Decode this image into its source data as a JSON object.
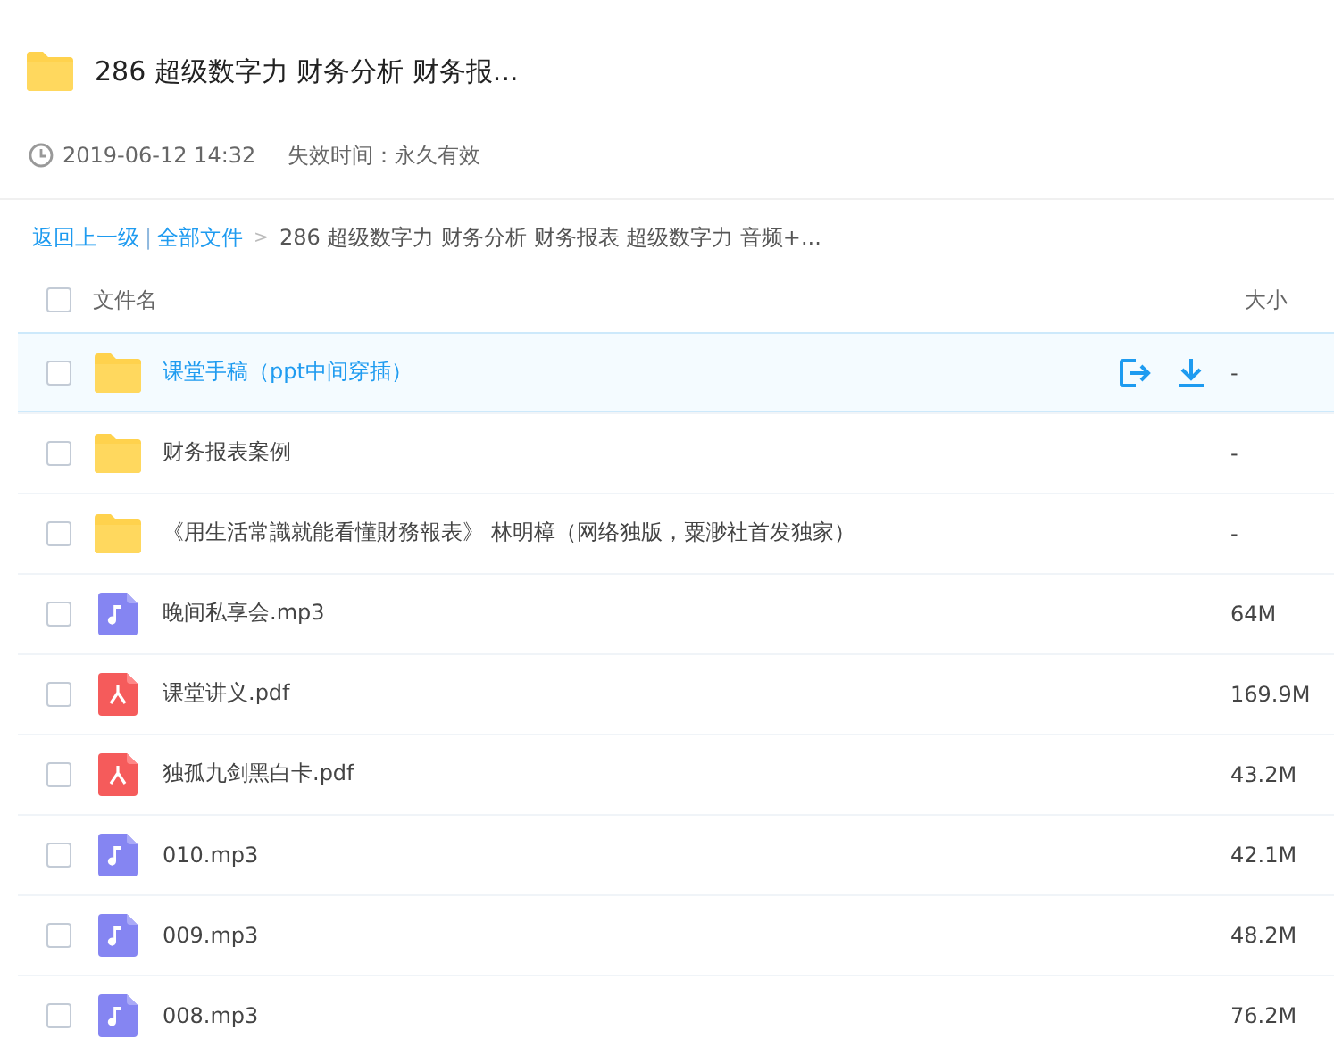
{
  "header": {
    "title": "286  超级数字力 财务分析 财务报...",
    "date": "2019-06-12 14:32",
    "expiry": "失效时间：永久有效"
  },
  "breadcrumb": {
    "back": "返回上一级",
    "separator": "|",
    "root": "全部文件",
    "arrow": ">",
    "current": "286 超级数字力 财务分析 财务报表 超级数字力 音频+..."
  },
  "table": {
    "select_all": {
      "checked": false
    },
    "columns": [
      "文件名",
      "大小"
    ],
    "rows": [
      {
        "kind": "folder",
        "name": "课堂手稿（ppt中间穿插）",
        "size": "-",
        "checked": false,
        "hovered": true
      },
      {
        "kind": "folder",
        "name": "财务报表案例",
        "size": "-",
        "checked": false,
        "hovered": false
      },
      {
        "kind": "folder",
        "name": "《用生活常識就能看懂財務報表》 林明樟（网络独版，粟渺社首发独家）",
        "size": "-",
        "checked": false,
        "hovered": false
      },
      {
        "kind": "audio",
        "name": "晚间私享会.mp3",
        "size": "64M",
        "checked": false,
        "hovered": false
      },
      {
        "kind": "pdf",
        "name": "课堂讲义.pdf",
        "size": "169.9M",
        "checked": false,
        "hovered": false
      },
      {
        "kind": "pdf",
        "name": "独孤九剑黑白卡.pdf",
        "size": "43.2M",
        "checked": false,
        "hovered": false
      },
      {
        "kind": "audio",
        "name": "010.mp3",
        "size": "42.1M",
        "checked": false,
        "hovered": false
      },
      {
        "kind": "audio",
        "name": "009.mp3",
        "size": "48.2M",
        "checked": false,
        "hovered": false
      },
      {
        "kind": "audio",
        "name": "008.mp3",
        "size": "76.2M",
        "checked": false,
        "hovered": false
      }
    ]
  }
}
